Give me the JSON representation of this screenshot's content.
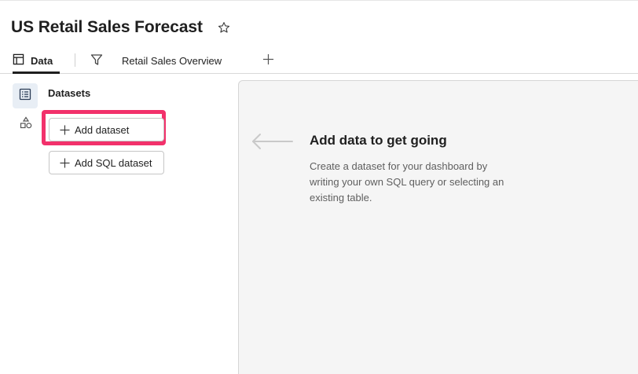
{
  "header": {
    "title": "US Retail Sales Forecast",
    "favorite_icon": "star-icon"
  },
  "tabs": [
    {
      "label": "Data",
      "icon": "table-icon",
      "active": true
    },
    {
      "label": "",
      "icon": "filter-icon",
      "active": false
    },
    {
      "label": "Retail Sales Overview",
      "icon": "",
      "active": false
    },
    {
      "label": "",
      "icon": "plus-icon",
      "active": false
    }
  ],
  "sidebar": {
    "rail": [
      {
        "icon": "dataset-list-icon",
        "active": true
      },
      {
        "icon": "shapes-icon",
        "active": false
      }
    ],
    "heading": "Datasets",
    "buttons": {
      "add_dataset": "Add dataset",
      "add_sql_dataset": "Add SQL dataset"
    },
    "highlight_color": "#f2316b"
  },
  "main": {
    "empty_state": {
      "title": "Add data to get going",
      "description": "Create a dataset for your dashboard by writing your own SQL query or selecting an existing table.",
      "icon": "arrow-left-icon"
    }
  },
  "colors": {
    "accent_highlight": "#f2316b",
    "panel_background": "#f5f5f5",
    "rail_active_background": "#e8eef5"
  }
}
